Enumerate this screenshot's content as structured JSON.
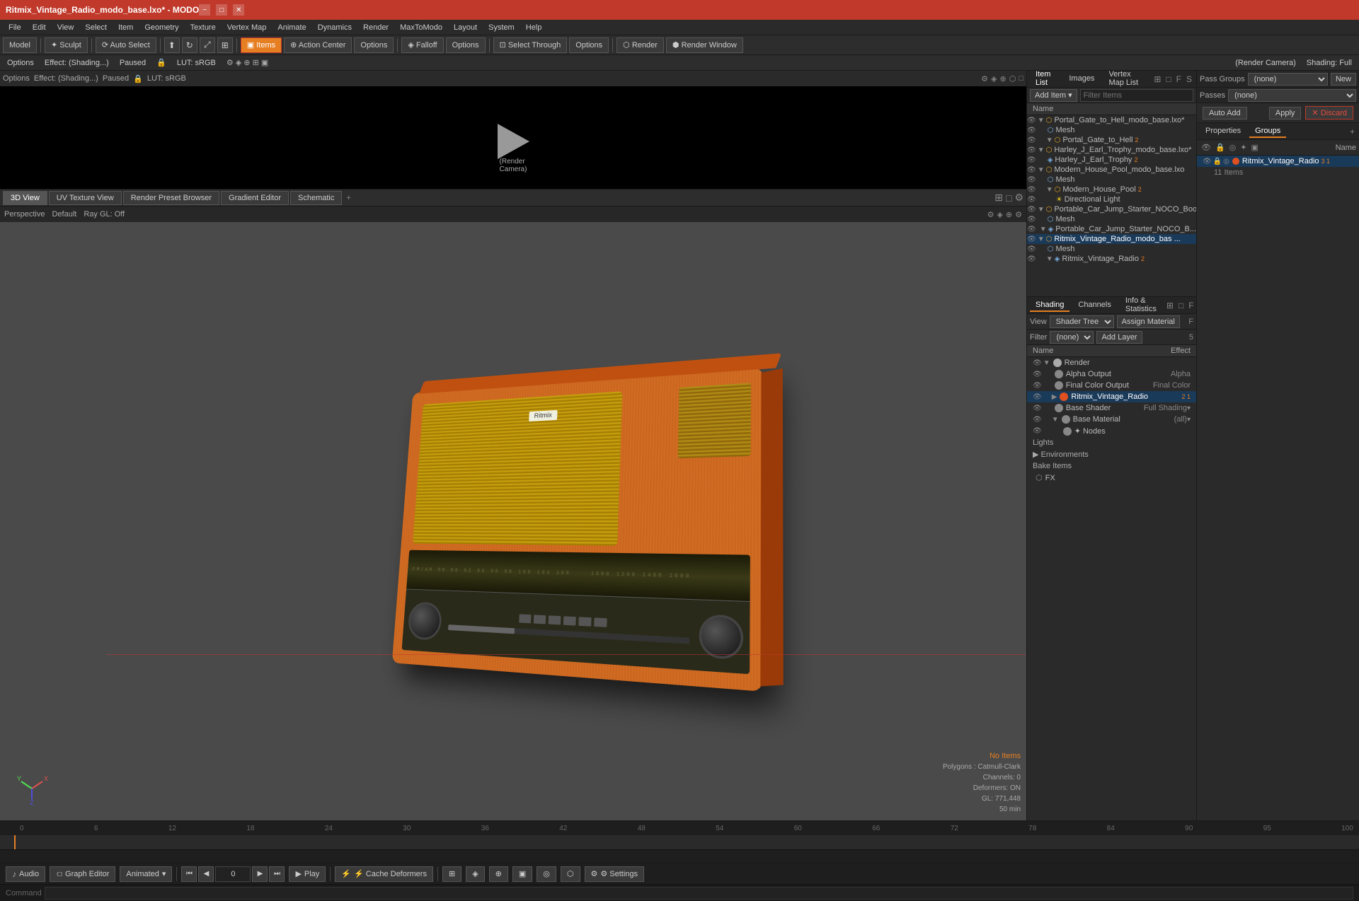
{
  "titlebar": {
    "title": "Ritmix_Vintage_Radio_modo_base.lxo* - MODO",
    "minimize": "−",
    "maximize": "□",
    "close": "✕"
  },
  "menubar": {
    "items": [
      "File",
      "Edit",
      "View",
      "Select",
      "Item",
      "Geometry",
      "Texture",
      "Vertex Map",
      "Animate",
      "Dynamics",
      "Render",
      "MaxToModo",
      "Layout",
      "System",
      "Help"
    ]
  },
  "toolbar": {
    "mode_model": "Model",
    "mode_sculpt": "✦ Sculpt",
    "auto_select": "⟳ Auto Select",
    "items_label": "▣ Items",
    "action_center": "⊕ Action Center",
    "options1": "Options",
    "falloff": "◈ Falloff",
    "options2": "Options",
    "select_through": "⊡ Select Through",
    "options3": "Options",
    "render": "⬡ Render",
    "render_window": "⬢ Render Window"
  },
  "toolbar2": {
    "options": "Options",
    "effect_label": "Effect: (Shading...)",
    "paused": "Paused",
    "lock": "🔒",
    "lut": "LUT: sRGB",
    "render_camera": "(Render Camera)",
    "shading": "Shading: Full"
  },
  "viewport_tabs": {
    "tabs": [
      "3D View",
      "UV Texture View",
      "Render Preset Browser",
      "Gradient Editor",
      "Schematic"
    ],
    "add": "+"
  },
  "viewport3d": {
    "perspective": "Perspective",
    "default": "Default",
    "ray_gl": "Ray GL: Off"
  },
  "stats": {
    "no_items": "No Items",
    "polygons": "Polygons : Catmull-Clark",
    "channels": "Channels: 0",
    "deformers": "Deformers: ON",
    "gl": "GL: 771,448",
    "value": "50 min"
  },
  "item_list": {
    "panel_tabs": [
      "Item List",
      "Images",
      "Vertex Map List"
    ],
    "add_item": "Add Item",
    "filter_placeholder": "Filter Items",
    "name_header": "Name",
    "items": [
      {
        "id": 0,
        "indent": 0,
        "arrow": "▼",
        "icon": "scene",
        "name": "Portal_Gate_to_Hell_modo_base.lxo*",
        "expanded": true
      },
      {
        "id": 1,
        "indent": 1,
        "arrow": "",
        "icon": "mesh",
        "name": "Mesh",
        "expanded": false
      },
      {
        "id": 2,
        "indent": 1,
        "arrow": "▼",
        "icon": "scene",
        "name": "Portal_Gate_to_Hell",
        "badge": "2",
        "expanded": true
      },
      {
        "id": 3,
        "indent": 0,
        "arrow": "▼",
        "icon": "scene",
        "name": "Harley_J_Earl_Trophy_modo_base.lxo*",
        "expanded": true
      },
      {
        "id": 4,
        "indent": 1,
        "arrow": "",
        "icon": "mesh",
        "name": "Harley_J_Earl_Trophy",
        "badge": "2",
        "expanded": false
      },
      {
        "id": 5,
        "indent": 0,
        "arrow": "▼",
        "icon": "scene",
        "name": "Modern_House_Pool_modo_base.lxo",
        "expanded": true
      },
      {
        "id": 6,
        "indent": 1,
        "arrow": "",
        "icon": "mesh",
        "name": "Mesh",
        "expanded": false
      },
      {
        "id": 7,
        "indent": 1,
        "arrow": "▼",
        "icon": "scene",
        "name": "Modern_House_Pool",
        "badge": "2",
        "expanded": true
      },
      {
        "id": 8,
        "indent": 2,
        "arrow": "",
        "icon": "light",
        "name": "Directional Light",
        "expanded": false
      },
      {
        "id": 9,
        "indent": 0,
        "arrow": "▼",
        "icon": "scene",
        "name": "Portable_Car_Jump_Starter_NOCO_Boo...",
        "expanded": true
      },
      {
        "id": 10,
        "indent": 1,
        "arrow": "",
        "icon": "mesh",
        "name": "Mesh",
        "expanded": false
      },
      {
        "id": 11,
        "indent": 1,
        "arrow": "▼",
        "icon": "scene",
        "name": "Portable_Car_Jump_Starter_NOCO_B...",
        "expanded": false
      },
      {
        "id": 12,
        "indent": 0,
        "arrow": "▼",
        "icon": "scene",
        "name": "Ritmix_Vintage_Radio_modo_bas ...",
        "selected": true,
        "expanded": true
      },
      {
        "id": 13,
        "indent": 1,
        "arrow": "",
        "icon": "mesh",
        "name": "Mesh",
        "expanded": false
      },
      {
        "id": 14,
        "indent": 1,
        "arrow": "▼",
        "icon": "scene",
        "name": "Ritmix_Vintage_Radio",
        "badge": "2",
        "expanded": false
      }
    ]
  },
  "shading": {
    "panel_tabs": [
      "Shading",
      "Channels",
      "Info & Statistics"
    ],
    "viewer_label": "View",
    "viewer_value": "Shader Tree",
    "assign_material": "Assign Material",
    "filter_label": "Filter",
    "filter_value": "(none)",
    "add_layer": "Add Layer",
    "name_header": "Name",
    "effect_header": "Effect",
    "items": [
      {
        "id": 0,
        "indent": 0,
        "arrow": "▼",
        "color": "#aaaaaa",
        "name": "Render",
        "effect": "",
        "type": "render"
      },
      {
        "id": 1,
        "indent": 1,
        "arrow": "",
        "color": "#888888",
        "name": "Alpha Output",
        "effect": "Alpha",
        "type": "output"
      },
      {
        "id": 2,
        "indent": 1,
        "arrow": "",
        "color": "#888888",
        "name": "Final Color Output",
        "effect": "Final Color",
        "type": "output"
      },
      {
        "id": 3,
        "indent": 1,
        "arrow": "▶",
        "color": "#e05020",
        "name": "Ritmix_Vintage_Radio",
        "badge": "2 1",
        "effect": "",
        "type": "material",
        "selected": true
      },
      {
        "id": 4,
        "indent": 1,
        "arrow": "",
        "color": "#888888",
        "name": "Base Shader",
        "effect": "Full Shading",
        "type": "shader"
      },
      {
        "id": 5,
        "indent": 1,
        "arrow": "▼",
        "color": "#888888",
        "name": "Base Material",
        "effect": "(all)",
        "type": "material"
      },
      {
        "id": 6,
        "indent": 2,
        "arrow": "",
        "color": "#888888",
        "name": "✦ Nodes",
        "effect": "",
        "type": "nodes"
      }
    ],
    "sections": [
      "Lights",
      "Environments",
      "Bake Items",
      "FX"
    ]
  },
  "pass_groups": {
    "label": "Pass Groups",
    "value": "(none)",
    "new_btn": "New",
    "passes_label": "Passes",
    "passes_value": "(none)"
  },
  "auto_add": {
    "label": "Auto Add",
    "apply": "Apply",
    "discard_x": "✕",
    "discard": "Discard"
  },
  "prop_tabs": {
    "tabs": [
      "Properties",
      "Groups"
    ],
    "icons": [
      "+"
    ]
  },
  "groups": {
    "toolbar_icons": [
      "👁",
      "🔒",
      "◎",
      "✦",
      "▣"
    ],
    "name_header": "Name",
    "items": [
      {
        "name": "Ritmix_Vintage_Radio",
        "badge": "3 1",
        "color": "#e05020",
        "selected": true
      }
    ],
    "sub_items": [
      {
        "name": "11 Items",
        "indent": 1
      }
    ]
  },
  "timeline": {
    "frame": "0",
    "marks": [
      "0",
      "6",
      "12",
      "18",
      "24",
      "30",
      "36",
      "42",
      "48",
      "54",
      "60",
      "66",
      "72",
      "78",
      "84",
      "90",
      "95",
      "100"
    ]
  },
  "bottom_bar": {
    "audio": "♪ Audio",
    "graph_editor": "Graph Editor",
    "animated_label": "Animated",
    "frame_input": "0",
    "play": "▶ Play",
    "cache_deformers": "⚡ Cache Deformers",
    "settings": "⚙ Settings"
  },
  "command_bar": {
    "label": "Command",
    "placeholder": ""
  }
}
